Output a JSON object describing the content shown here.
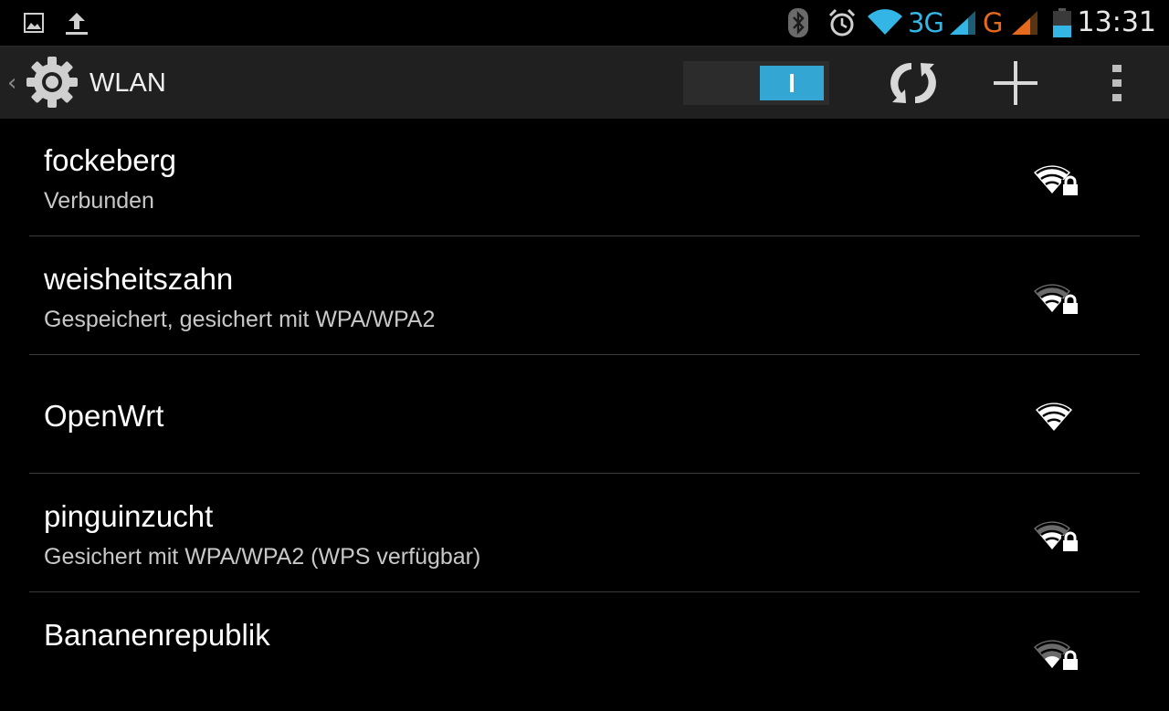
{
  "status_bar": {
    "left_icons": [
      "gallery-icon",
      "upload-icon"
    ],
    "right_icons": [
      "bluetooth-icon",
      "alarm-icon",
      "wifi-signal-icon",
      "cell-signal-icon"
    ],
    "network_3g": "3G",
    "network_g": "G",
    "time": "13:31",
    "colors": {
      "network_3g": "#33b5e5",
      "network_g": "#e66a1e"
    }
  },
  "action_bar": {
    "title": "WLAN",
    "app_icon": "settings-gear-icon",
    "wifi_switch": {
      "state": "on",
      "accent": "#33a6d4"
    },
    "actions": [
      "wps-refresh-icon",
      "add-network-icon",
      "overflow-menu-icon"
    ]
  },
  "networks": [
    {
      "ssid": "fockeberg",
      "status": "Verbunden",
      "secured": true,
      "signal": 4
    },
    {
      "ssid": "weisheitszahn",
      "status": "Gespeichert, gesichert mit WPA/WPA2",
      "secured": true,
      "signal": 3
    },
    {
      "ssid": "OpenWrt",
      "status": "",
      "secured": false,
      "signal": 4
    },
    {
      "ssid": "pinguinzucht",
      "status": "Gesichert mit WPA/WPA2 (WPS verfügbar)",
      "secured": true,
      "signal": 3
    },
    {
      "ssid": "Bananenrepublik",
      "status": "",
      "secured": true,
      "signal": 2
    }
  ]
}
